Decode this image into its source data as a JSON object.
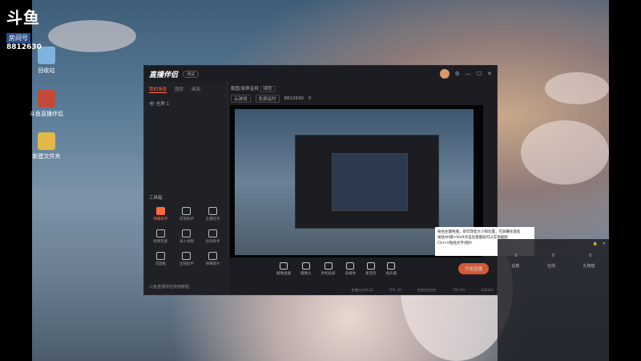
{
  "overlay": {
    "logo": "斗鱼",
    "room_label": "房间号",
    "room_number": "8812630"
  },
  "desktop_icons": [
    {
      "label": "回收站",
      "icon": "recycle-bin-icon"
    },
    {
      "label": "斗鱼直播伴侣",
      "icon": "app-icon"
    },
    {
      "label": "新建文件夹",
      "icon": "folder-icon"
    }
  ],
  "window": {
    "brand": "直播伴侣",
    "version_pill": "测试",
    "sidebar_tabs": [
      "我的场景",
      "图层",
      "画面"
    ],
    "scene_item": "全屏 1",
    "tools_title": "工具箱",
    "tools": [
      {
        "label": "弹幕助手",
        "active": true
      },
      {
        "label": "房管助手",
        "active": false
      },
      {
        "label": "主播任务",
        "active": false
      },
      {
        "label": "视频连麦",
        "active": false
      },
      {
        "label": "录入视频",
        "active": false
      },
      {
        "label": "投屏助手",
        "active": false
      },
      {
        "label": "话题推",
        "active": false
      },
      {
        "label": "连线助手",
        "active": false
      },
      {
        "label": "弹幕图片",
        "active": false
      }
    ],
    "sidebar_footer": "斗鱼直播伴侣使用教程",
    "top_info": {
      "title": "截图/录屏音频",
      "chip": "绿色",
      "sub1": "云游戏",
      "sub2": "免费延时",
      "sub3": "8812630",
      "count": "0"
    },
    "bottom_buttons": [
      "摄像直播",
      "摄像头",
      "手机投屏",
      "多媒体",
      "麦克风",
      "扬声器"
    ],
    "start_label": "开始直播",
    "status": [
      "直播时长00:00",
      "FPS: 30",
      "网络状态良好",
      "CPU 8%",
      "码率0kb"
    ]
  },
  "tooltip": {
    "lines": [
      "按住左键拖拽，即可改变大小和位置，在屏幕任意处",
      "按住Alt键+Shift点击任意键就可以实现截图",
      "Ctrl+V粘贴文字/图片"
    ]
  },
  "panel": {
    "stats": [
      {
        "label": "总数",
        "value": "0"
      },
      {
        "label": "在线",
        "value": "0"
      },
      {
        "label": "礼物值",
        "value": "0"
      }
    ]
  }
}
